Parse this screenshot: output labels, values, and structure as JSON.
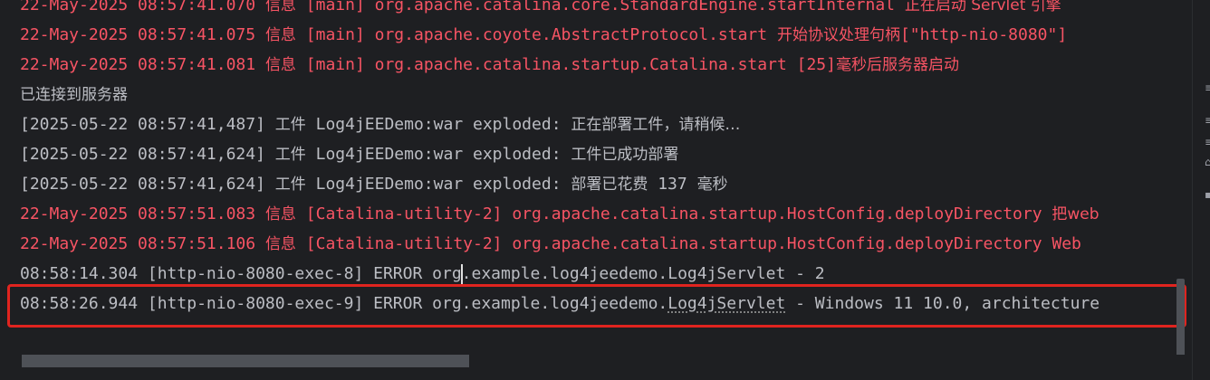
{
  "console": {
    "lines": [
      {
        "color": "red",
        "segments": [
          {
            "t": "22-May-2025 08:57:41.070 "
          },
          {
            "t": "信息",
            "cjk": true
          },
          {
            "t": " [main] org.apache.catalina.core.StandardEngine.startInternal "
          },
          {
            "t": "正在启动 Servlet 引擎",
            "cjk": true
          }
        ]
      },
      {
        "color": "red",
        "segments": [
          {
            "t": "22-May-2025 08:57:41.075 "
          },
          {
            "t": "信息",
            "cjk": true
          },
          {
            "t": " [main] org.apache.coyote.AbstractProtocol.start "
          },
          {
            "t": "开始协议处理句柄",
            "cjk": true
          },
          {
            "t": "[\"http-nio-8080\"]"
          }
        ]
      },
      {
        "color": "red",
        "segments": [
          {
            "t": "22-May-2025 08:57:41.081 "
          },
          {
            "t": "信息",
            "cjk": true
          },
          {
            "t": " [main] org.apache.catalina.startup.Catalina.start [25]"
          },
          {
            "t": "毫秒后服务器启动",
            "cjk": true
          }
        ]
      },
      {
        "color": "white",
        "segments": [
          {
            "t": "已连接到服务器",
            "cjk": true
          }
        ]
      },
      {
        "color": "white",
        "segments": [
          {
            "t": "[2025-05-22 08:57:41,487] "
          },
          {
            "t": "工件",
            "cjk": true
          },
          {
            "t": " Log4jEEDemo:war exploded: "
          },
          {
            "t": "正在部署工件，请稍候…",
            "cjk": true
          }
        ]
      },
      {
        "color": "white",
        "segments": [
          {
            "t": "[2025-05-22 08:57:41,624] "
          },
          {
            "t": "工件",
            "cjk": true
          },
          {
            "t": " Log4jEEDemo:war exploded: "
          },
          {
            "t": "工件已成功部署",
            "cjk": true
          }
        ]
      },
      {
        "color": "white",
        "segments": [
          {
            "t": "[2025-05-22 08:57:41,624] "
          },
          {
            "t": "工件",
            "cjk": true
          },
          {
            "t": " Log4jEEDemo:war exploded: "
          },
          {
            "t": "部署已花费",
            "cjk": true
          },
          {
            "t": " 137 "
          },
          {
            "t": "毫秒",
            "cjk": true
          }
        ]
      },
      {
        "color": "red",
        "segments": [
          {
            "t": "22-May-2025 08:57:51.083 "
          },
          {
            "t": "信息",
            "cjk": true
          },
          {
            "t": " [Catalina-utility-2] org.apache.catalina.startup.HostConfig.deployDirectory "
          },
          {
            "t": "把web",
            "cjk": true
          }
        ]
      },
      {
        "color": "red",
        "segments": [
          {
            "t": "22-May-2025 08:57:51.106 "
          },
          {
            "t": "信息",
            "cjk": true
          },
          {
            "t": " [Catalina-utility-2] org.apache.catalina.startup.HostConfig.deployDirectory Web"
          }
        ]
      },
      {
        "color": "white",
        "segments": [
          {
            "t": "08:58:14.304 [http-nio-8080-exec-8] ERROR org"
          },
          {
            "caret": true
          },
          {
            "t": ".example.log4jeedemo.Log4jServlet - 2"
          }
        ]
      },
      {
        "color": "white",
        "segments": [
          {
            "t": "08:58:26.944 [http-nio-8080-exec-9] ERROR org.example.log4jeedemo."
          },
          {
            "t": "Log4jServlet",
            "dotted": true
          },
          {
            "t": " - Windows 11 10.0, architecture"
          }
        ]
      }
    ]
  },
  "colors": {
    "background": "#1e1f22",
    "log_red": "#f75464",
    "log_white": "#bcbec4",
    "highlight_border": "#e0241f"
  },
  "gutter_icons": [
    "lines-icon",
    "lines-icon",
    "lines-icon",
    "lock-icon",
    "lines-icon"
  ],
  "status_fragment": "(cut off)"
}
